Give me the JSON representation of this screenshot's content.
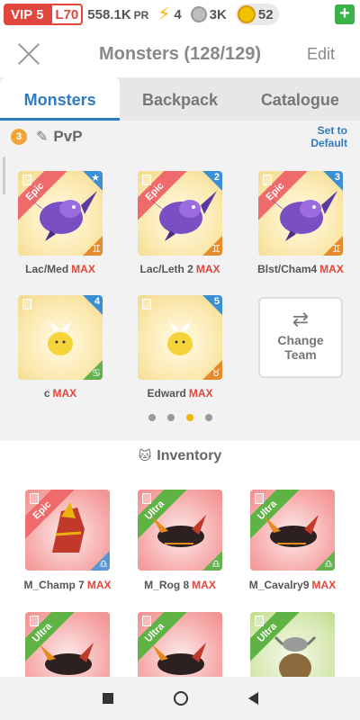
{
  "status": {
    "vip": "VIP 5",
    "level": "L70",
    "power": "558.1K",
    "power_unit": "PR",
    "energy": "4",
    "food": "3K",
    "coins": "52",
    "plus": "+"
  },
  "header": {
    "title": "Monsters (128/129)",
    "edit": "Edit"
  },
  "tabs": [
    "Monsters",
    "Backpack",
    "Catalogue"
  ],
  "team": {
    "number": "3",
    "name": "PvP",
    "set_default": "Set to Default",
    "members": [
      {
        "name": "Lac/Med",
        "level": "MAX",
        "rarity": "Epic",
        "slot": "★",
        "element": "♊",
        "card": "gold"
      },
      {
        "name": "Lac/Leth 2",
        "level": "MAX",
        "rarity": "Epic",
        "slot": "2",
        "element": "♊",
        "card": "gold"
      },
      {
        "name": "Blst/Cham4",
        "level": "MAX",
        "rarity": "Epic",
        "slot": "3",
        "element": "♊",
        "card": "gold"
      },
      {
        "name": "c",
        "level": "MAX",
        "rarity": "",
        "slot": "4",
        "element": "♋",
        "card": "gold"
      },
      {
        "name": "Edward",
        "level": "MAX",
        "rarity": "",
        "slot": "5",
        "element": "♉",
        "card": "gold"
      }
    ],
    "change_team": "Change Team",
    "page_dots": 4,
    "active_dot": 3
  },
  "inventory": {
    "title": "Inventory",
    "items": [
      {
        "name": "M_Champ 7",
        "level": "MAX",
        "rarity": "Epic",
        "card": "red"
      },
      {
        "name": "M_Rog 8",
        "level": "MAX",
        "rarity": "Ultra",
        "card": "red"
      },
      {
        "name": "M_Cavalry9",
        "level": "MAX",
        "rarity": "Ultra",
        "card": "red"
      },
      {
        "name": "",
        "level": "",
        "rarity": "Ultra",
        "card": "red"
      },
      {
        "name": "",
        "level": "",
        "rarity": "Ultra",
        "card": "red"
      },
      {
        "name": "",
        "level": "",
        "rarity": "Ultra",
        "card": "green"
      }
    ]
  }
}
